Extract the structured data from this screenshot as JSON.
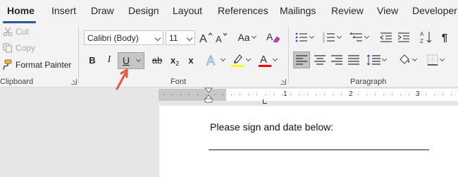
{
  "tabs": [
    "Home",
    "Insert",
    "Draw",
    "Design",
    "Layout",
    "References",
    "Mailings",
    "Review",
    "View",
    "Developer"
  ],
  "clipboard": {
    "cut_label": "Cut",
    "copy_label": "Copy",
    "format_painter_label": "Format Painter",
    "group_label": "Clipboard"
  },
  "font": {
    "font_name": "Calibri (Body)",
    "font_size": "11",
    "bold_label": "B",
    "italic_label": "I",
    "underline_label": "U",
    "strike_label": "ab",
    "subscript_label": "x",
    "subscript_sub": "2",
    "superscript_label": "x",
    "superscript_sup": "2",
    "change_case_label": "Aa",
    "group_label": "Font"
  },
  "paragraph": {
    "group_label": "Paragraph"
  },
  "ruler": {
    "numbers": [
      "1",
      "2",
      "3"
    ]
  },
  "document": {
    "text": "Please sign and date below:"
  },
  "colors": {
    "accent": "#2b579a",
    "highlight": "#ffff00",
    "font_color": "#ff0000",
    "arrow": "#e8553a"
  }
}
